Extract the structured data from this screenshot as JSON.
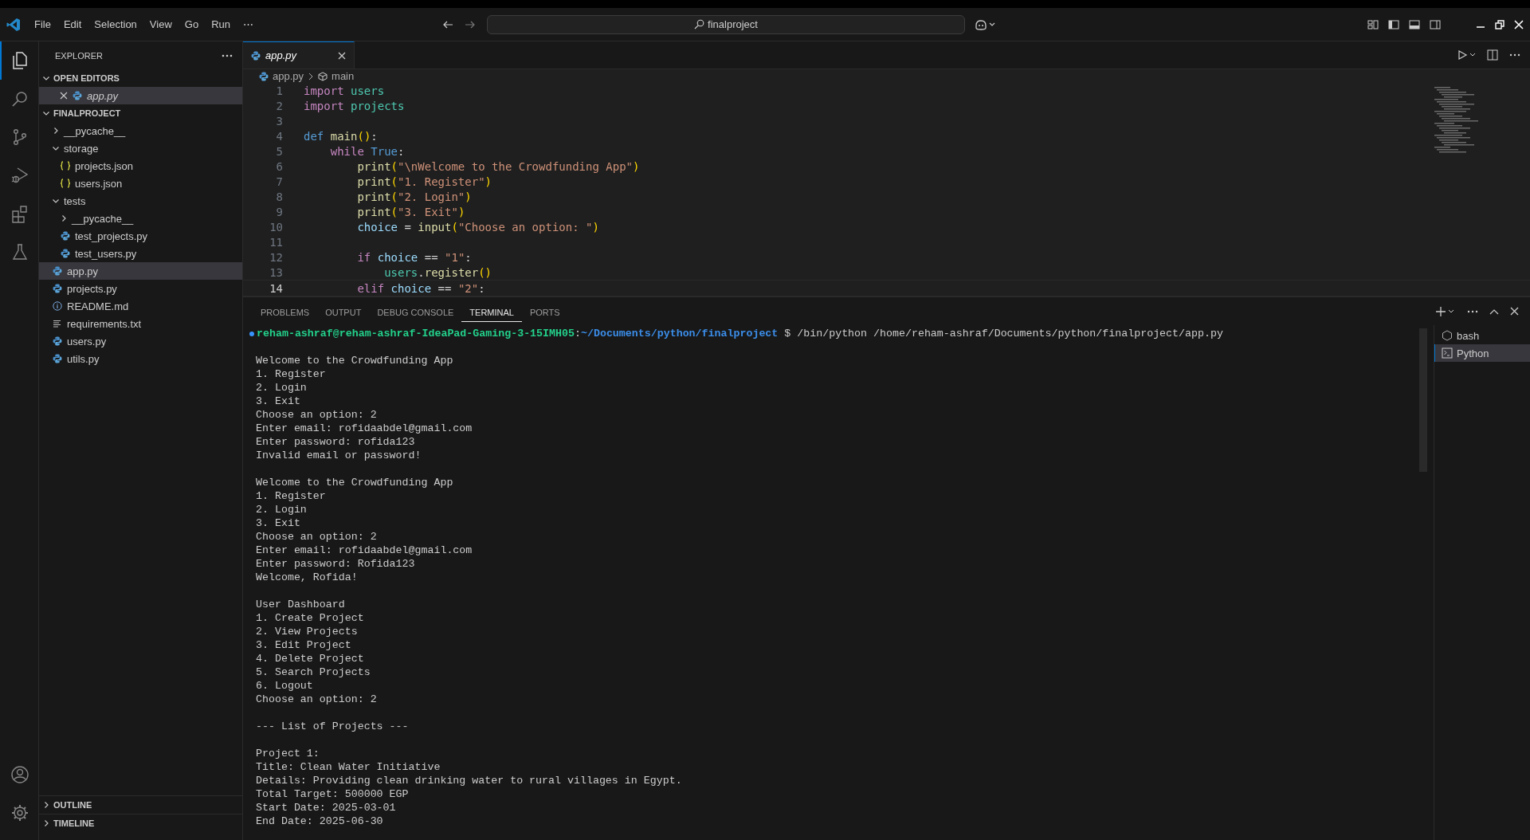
{
  "title_bar": {
    "menu": [
      "File",
      "Edit",
      "Selection",
      "View",
      "Go",
      "Run",
      "⋯"
    ],
    "search": "finalproject"
  },
  "activity_bar": [
    {
      "kind": "files",
      "selected": true
    },
    {
      "kind": "search",
      "selected": false
    },
    {
      "kind": "source-control",
      "selected": false
    },
    {
      "kind": "run",
      "selected": false
    },
    {
      "kind": "extensions",
      "selected": false
    },
    {
      "kind": "testing",
      "selected": false
    }
  ],
  "sidebar": {
    "title": "EXPLORER",
    "open_editors": {
      "label": "OPEN EDITORS",
      "expanded": true,
      "items": [
        {
          "name": "app.py",
          "kind": "python",
          "selected": true
        }
      ]
    },
    "folder": {
      "label": "FINALPROJECT",
      "expanded": true,
      "children": [
        {
          "name": "__pycache__",
          "kind": "folder",
          "expanded": false,
          "selected": false
        },
        {
          "name": "storage",
          "kind": "folder",
          "expanded": true,
          "selected": false,
          "children": [
            {
              "name": "projects.json",
              "kind": "json",
              "selected": false
            },
            {
              "name": "users.json",
              "kind": "json",
              "selected": false
            }
          ]
        },
        {
          "name": "tests",
          "kind": "folder",
          "expanded": true,
          "selected": false,
          "children": [
            {
              "name": "__pycache__",
              "kind": "folder",
              "expanded": false,
              "selected": false
            },
            {
              "name": "test_projects.py",
              "kind": "python",
              "selected": false
            },
            {
              "name": "test_users.py",
              "kind": "python",
              "selected": false
            }
          ]
        },
        {
          "name": "app.py",
          "kind": "python",
          "selected": true
        },
        {
          "name": "projects.py",
          "kind": "python",
          "selected": false
        },
        {
          "name": "README.md",
          "kind": "info",
          "selected": false
        },
        {
          "name": "requirements.txt",
          "kind": "text",
          "selected": false
        },
        {
          "name": "users.py",
          "kind": "python",
          "selected": false
        },
        {
          "name": "utils.py",
          "kind": "python",
          "selected": false
        }
      ]
    },
    "outline": {
      "label": "OUTLINE",
      "expanded": false
    },
    "timeline": {
      "label": "TIMELINE",
      "expanded": false
    }
  },
  "editor": {
    "tabs": [
      {
        "label": "app.py",
        "selected": true
      }
    ],
    "breadcrumb": [
      "app.py",
      "main"
    ],
    "lines": [
      {
        "number": "1",
        "current": false,
        "tokens": [
          {
            "kind": "keyword",
            "text": "import"
          },
          {
            "kind": "module",
            "text": " users"
          }
        ]
      },
      {
        "number": "2",
        "current": false,
        "tokens": [
          {
            "kind": "keyword",
            "text": "import"
          },
          {
            "kind": "module",
            "text": " projects"
          }
        ]
      },
      {
        "number": "3",
        "current": false
      },
      {
        "number": "4",
        "current": false,
        "tokens": [
          {
            "kind": "builtin",
            "text": "def"
          },
          {
            "kind": "function",
            "text": " main"
          },
          {
            "kind": "bracket",
            "text": "()"
          },
          {
            "kind": "plain",
            "text": ":"
          }
        ]
      },
      {
        "number": "5",
        "current": false,
        "tokens": [
          {
            "kind": "keyword",
            "text": "    while"
          },
          {
            "kind": "builtin",
            "text": " True"
          },
          {
            "kind": "plain",
            "text": ":"
          }
        ]
      },
      {
        "number": "6",
        "current": false,
        "tokens": [
          {
            "kind": "function",
            "text": "        print"
          },
          {
            "kind": "bracket",
            "text": "("
          },
          {
            "kind": "string",
            "text": "\"\\nWelcome to the Crowdfunding App\""
          },
          {
            "kind": "bracket",
            "text": ")"
          }
        ]
      },
      {
        "number": "7",
        "current": false,
        "tokens": [
          {
            "kind": "function",
            "text": "        print"
          },
          {
            "kind": "bracket",
            "text": "("
          },
          {
            "kind": "string",
            "text": "\"1. Register\""
          },
          {
            "kind": "bracket",
            "text": ")"
          }
        ]
      },
      {
        "number": "8",
        "current": false,
        "tokens": [
          {
            "kind": "function",
            "text": "        print"
          },
          {
            "kind": "bracket",
            "text": "("
          },
          {
            "kind": "string",
            "text": "\"2. Login\""
          },
          {
            "kind": "bracket",
            "text": ")"
          }
        ]
      },
      {
        "number": "9",
        "current": false,
        "tokens": [
          {
            "kind": "function",
            "text": "        print"
          },
          {
            "kind": "bracket",
            "text": "("
          },
          {
            "kind": "string",
            "text": "\"3. Exit\""
          },
          {
            "kind": "bracket",
            "text": ")"
          }
        ]
      },
      {
        "number": "10",
        "current": false,
        "tokens": [
          {
            "kind": "variable",
            "text": "        choice"
          },
          {
            "kind": "plain",
            "text": " = "
          },
          {
            "kind": "function",
            "text": "input"
          },
          {
            "kind": "bracket",
            "text": "("
          },
          {
            "kind": "string",
            "text": "\"Choose an option: \""
          },
          {
            "kind": "bracket",
            "text": ")"
          }
        ]
      },
      {
        "number": "11",
        "current": false
      },
      {
        "number": "12",
        "current": false,
        "tokens": [
          {
            "kind": "keyword",
            "text": "        if"
          },
          {
            "kind": "variable",
            "text": " choice"
          },
          {
            "kind": "plain",
            "text": " == "
          },
          {
            "kind": "string",
            "text": "\"1\""
          },
          {
            "kind": "plain",
            "text": ":"
          }
        ]
      },
      {
        "number": "13",
        "current": false,
        "tokens": [
          {
            "kind": "module",
            "text": "            users"
          },
          {
            "kind": "plain",
            "text": "."
          },
          {
            "kind": "function",
            "text": "register"
          },
          {
            "kind": "bracket",
            "text": "()"
          }
        ]
      },
      {
        "number": "14",
        "current": true,
        "tokens": [
          {
            "kind": "keyword",
            "text": "        elif"
          },
          {
            "kind": "variable",
            "text": " choice"
          },
          {
            "kind": "plain",
            "text": " == "
          },
          {
            "kind": "string",
            "text": "\"2\""
          },
          {
            "kind": "plain",
            "text": ":"
          }
        ]
      }
    ]
  },
  "panel": {
    "tabs": [
      {
        "label": "PROBLEMS",
        "selected": false
      },
      {
        "label": "OUTPUT",
        "selected": false
      },
      {
        "label": "DEBUG CONSOLE",
        "selected": false
      },
      {
        "label": "TERMINAL",
        "selected": true
      },
      {
        "label": "PORTS",
        "selected": false
      }
    ],
    "prompt": {
      "user": "reham-ashraf@reham-ashraf-IdeaPad-Gaming-3-15IMH05",
      "separator": ":",
      "path": "~/Documents/python/finalproject",
      "command": "$ /bin/python /home/reham-ashraf/Documents/python/finalproject/app.py"
    },
    "output": [
      [
        "Welcome to the Crowdfunding App",
        "1. Register",
        "2. Login",
        "3. Exit",
        "Choose an option: 2",
        "Enter email: rofidaabdel@gmail.com",
        "Enter password: rofida123",
        "Invalid email or password!"
      ],
      [
        "Welcome to the Crowdfunding App",
        "1. Register",
        "2. Login",
        "3. Exit",
        "Choose an option: 2",
        "Enter email: rofidaabdel@gmail.com",
        "Enter password: Rofida123",
        "Welcome, Rofida!"
      ],
      [
        "User Dashboard",
        "1. Create Project",
        "2. View Projects",
        "3. Edit Project",
        "4. Delete Project",
        "5. Search Projects",
        "6. Logout",
        "Choose an option: 2"
      ],
      [
        "--- List of Projects ---"
      ],
      [
        "Project 1:",
        "Title: Clean Water Initiative",
        "Details: Providing clean drinking water to rural villages in Egypt.",
        "Total Target: 500000 EGP",
        "Start Date: 2025-03-01",
        "End Date: 2025-06-30"
      ]
    ],
    "terminals": [
      {
        "name": "bash",
        "kind": "bash",
        "selected": false
      },
      {
        "name": "Python",
        "kind": "python",
        "selected": true
      }
    ]
  }
}
